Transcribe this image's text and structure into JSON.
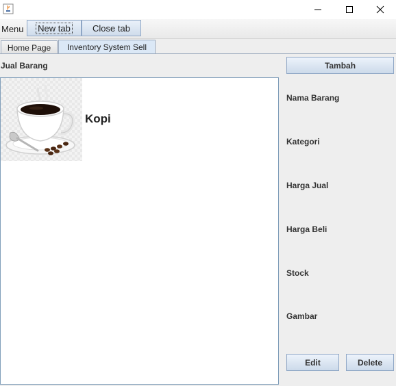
{
  "menubar": {
    "menu_label": "Menu",
    "new_tab_label": "New tab",
    "close_tab_label": "Close tab"
  },
  "tabs": [
    {
      "label": "Home Page",
      "selected": false
    },
    {
      "label": "Inventory System Sell",
      "selected": true
    }
  ],
  "section_title": "Jual Barang",
  "items": [
    {
      "name": "Kopi",
      "image": "coffee-cup-image"
    }
  ],
  "details": {
    "add_label": "Tambah",
    "fields": [
      {
        "label": "Nama Barang"
      },
      {
        "label": "Kategori"
      },
      {
        "label": "Harga Jual"
      },
      {
        "label": "Harga Beli"
      },
      {
        "label": "Stock"
      },
      {
        "label": "Gambar"
      }
    ],
    "edit_label": "Edit",
    "delete_label": "Delete"
  },
  "colors": {
    "selected_tab": "#dbe8f6",
    "button_border": "#8ea6c5",
    "panel_border": "#7f9db9"
  },
  "icons": [
    "java-app-icon",
    "minimize-icon",
    "maximize-icon",
    "close-icon"
  ]
}
